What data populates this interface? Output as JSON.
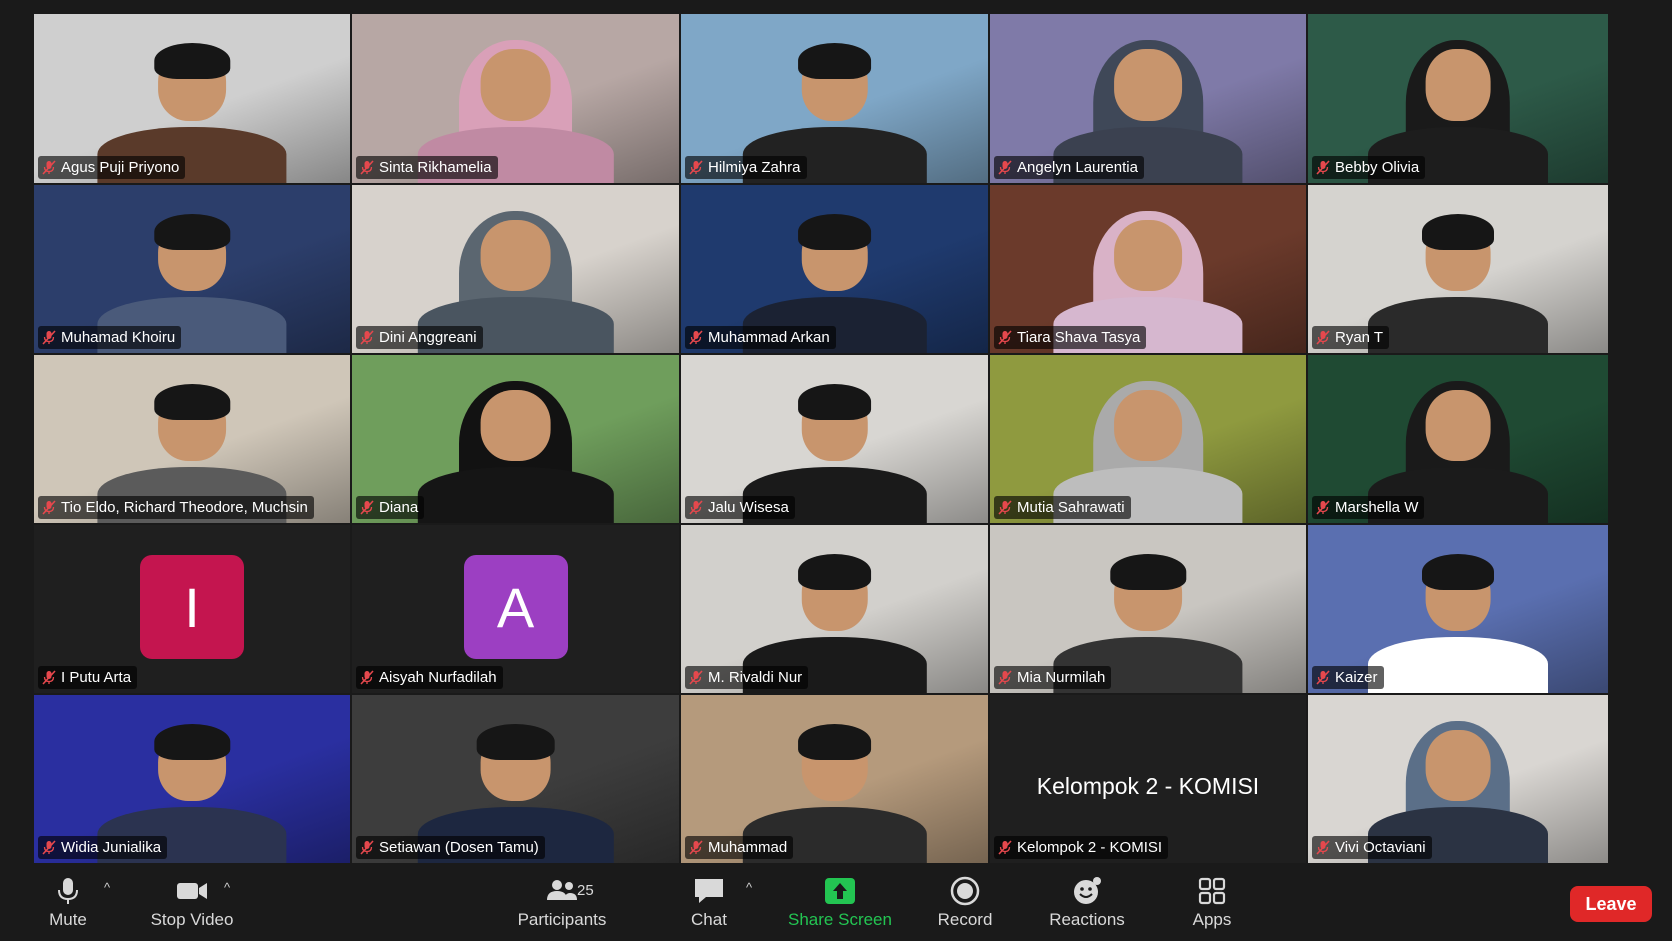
{
  "participants": [
    {
      "name": "Agus Puji Priyono",
      "bg": "#cfcfcf",
      "shirt": "#5a3a2a",
      "style": "man"
    },
    {
      "name": "Sinta Rikhamelia",
      "bg": "#b7a7a4",
      "shirt": "#c08aa3",
      "style": "hijab",
      "hijab": "#d9a0b8"
    },
    {
      "name": "Hilmiya Zahra",
      "bg": "#7fa7c7",
      "shirt": "#222222",
      "style": "man"
    },
    {
      "name": "Angelyn Laurentia",
      "bg": "#7f7aa8",
      "shirt": "#3b4150",
      "style": "hijab",
      "hijab": "#3f4858"
    },
    {
      "name": "Bebby Olivia",
      "bg": "#2d5a48",
      "shirt": "#1d1d1d",
      "style": "hijab",
      "hijab": "#1a1a1a"
    },
    {
      "name": "Muhamad Khoiru",
      "bg": "#2c3e6b",
      "shirt": "#4a5a7a",
      "style": "man"
    },
    {
      "name": "Dini Anggreani",
      "bg": "#d7d2cc",
      "shirt": "#4a5560",
      "style": "hijab",
      "hijab": "#5b6670"
    },
    {
      "name": "Muhammad Arkan",
      "bg": "#1f3a6e",
      "shirt": "#1b2233",
      "style": "man"
    },
    {
      "name": "Tiara Shava Tasya",
      "bg": "#6b3a2b",
      "shirt": "#d6b7cf",
      "style": "hijab",
      "hijab": "#d9b2c7"
    },
    {
      "name": "Ryan T",
      "bg": "#d5d3cf",
      "shirt": "#2a2a2a",
      "style": "man"
    },
    {
      "name": "Tio Eldo, Richard Theodore, Muchsin",
      "bg": "#cfc6b8",
      "shirt": "#5b5b5b",
      "style": "man"
    },
    {
      "name": "Diana",
      "bg": "#6f9e5c",
      "shirt": "#151515",
      "style": "hijab",
      "hijab": "#121212"
    },
    {
      "name": "Jalu Wisesa",
      "bg": "#d8d6d2",
      "shirt": "#1a1a1a",
      "style": "man"
    },
    {
      "name": "Mutia Sahrawati",
      "bg": "#8f9a3f",
      "shirt": "#bdbdbd",
      "style": "hijab",
      "hijab": "#aaaaaa"
    },
    {
      "name": "Marshella W",
      "bg": "#1f4a33",
      "shirt": "#1b1b1b",
      "style": "hijab",
      "hijab": "#1a1a1a"
    },
    {
      "name": "I Putu Arta",
      "style": "avatar",
      "letter": "I",
      "color": "#c4154f"
    },
    {
      "name": "Aisyah Nurfadilah",
      "style": "avatar",
      "letter": "A",
      "color": "#9c3fc2"
    },
    {
      "name": "M. Rivaldi Nur",
      "bg": "#d2d0cc",
      "shirt": "#1a1a1a",
      "style": "man"
    },
    {
      "name": "Mia Nurmilah",
      "bg": "#c9c6c1",
      "shirt": "#333333",
      "style": "man"
    },
    {
      "name": "Kaizer",
      "bg": "#5a6fb0",
      "shirt": "#ffffff",
      "style": "man"
    },
    {
      "name": "Widia Junialika",
      "bg": "#2a2fa0",
      "shirt": "#2b3350",
      "style": "man"
    },
    {
      "name": "Setiawan (Dosen Tamu)",
      "bg": "#3d3d3d",
      "shirt": "#1d2740",
      "style": "man",
      "speaking": true
    },
    {
      "name": "Muhammad",
      "bg": "#b59a7c",
      "shirt": "#2b2b2b",
      "style": "man"
    },
    {
      "name": "Kelompok 2 - KOMISI",
      "style": "text",
      "display": "Kelompok 2 - KOMISI"
    },
    {
      "name": "Vivi Octaviani",
      "bg": "#d9d6d2",
      "shirt": "#2b3343",
      "style": "hijab",
      "hijab": "#5b6f88"
    }
  ],
  "toolbar": {
    "mute": "Mute",
    "stop_video": "Stop Video",
    "participants": "Participants",
    "participants_count": "25",
    "chat": "Chat",
    "share_screen": "Share Screen",
    "record": "Record",
    "reactions": "Reactions",
    "apps": "Apps",
    "leave": "Leave"
  },
  "colors": {
    "share_green": "#23c552",
    "leave_red": "#e02828",
    "speaking_border": "#23c552"
  }
}
